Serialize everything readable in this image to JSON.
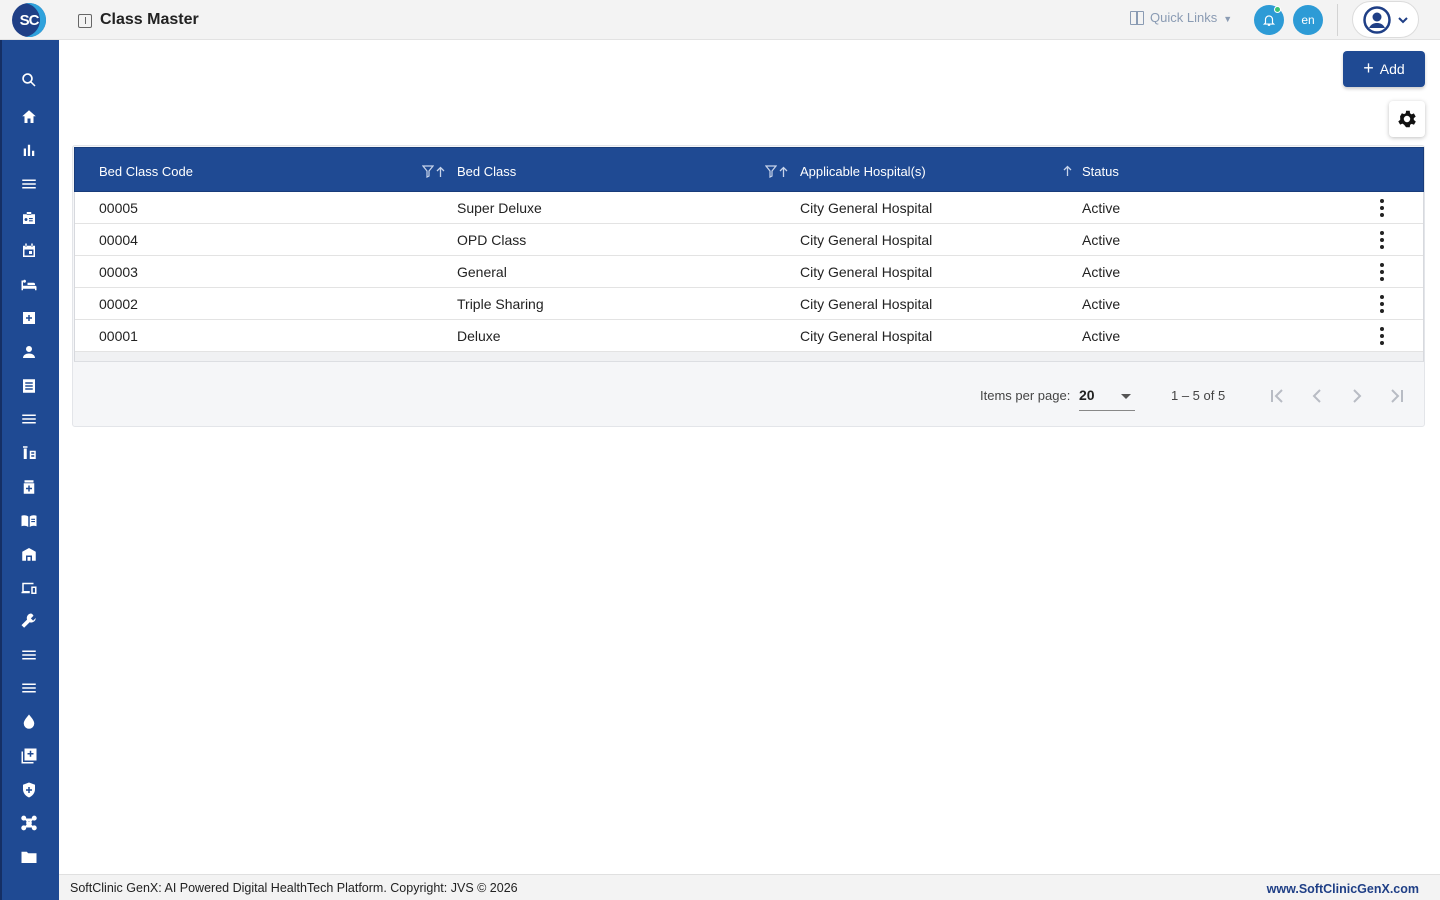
{
  "header": {
    "logo_text": "SC",
    "title": "Class Master",
    "quick_links_label": "Quick Links",
    "lang_label": "en",
    "icons": [
      "page-icon",
      "gift-icon",
      "bell-icon",
      "user-avatar-icon",
      "chevron-down-icon"
    ]
  },
  "sidebar": {
    "icons": [
      "search-icon",
      "home-icon",
      "bar-chart-icon",
      "menu-icon",
      "badge-icon",
      "calendar-icon",
      "bed-icon",
      "medical-kit-icon",
      "person-icon",
      "receipt-icon",
      "list-icon",
      "medication-icon",
      "pill-bottle-icon",
      "menu-book-icon",
      "warehouse-icon",
      "devices-icon",
      "wrench-icon",
      "lines-icon",
      "lines-alt-icon",
      "drop-icon",
      "add-box-icon",
      "shield-icon",
      "hub-icon",
      "folder-icon"
    ]
  },
  "toolbar": {
    "add_label": "Add"
  },
  "table": {
    "columns": [
      "Bed Class Code",
      "Bed Class",
      "Applicable Hospital(s)",
      "Status"
    ],
    "rows": [
      {
        "code": "00005",
        "bed_class": "Super Deluxe",
        "hospital": "City General Hospital",
        "status": "Active"
      },
      {
        "code": "00004",
        "bed_class": "OPD Class",
        "hospital": "City General Hospital",
        "status": "Active"
      },
      {
        "code": "00003",
        "bed_class": "General",
        "hospital": "City General Hospital",
        "status": "Active"
      },
      {
        "code": "00002",
        "bed_class": "Triple Sharing",
        "hospital": "City General Hospital",
        "status": "Active"
      },
      {
        "code": "00001",
        "bed_class": "Deluxe",
        "hospital": "City General Hospital",
        "status": "Active"
      }
    ]
  },
  "paginator": {
    "items_per_page_label": "Items per page:",
    "items_per_page_value": "20",
    "range_label": "1 – 5 of 5"
  },
  "footer": {
    "copyright": "SoftClinic GenX: AI Powered Digital HealthTech Platform. Copyright: JVS © 2026",
    "website": "www.SoftClinicGenX.com"
  },
  "colors": {
    "primary": "#1f4a93",
    "accent": "#2d9bd6",
    "notification_dot": "#3ac274"
  }
}
